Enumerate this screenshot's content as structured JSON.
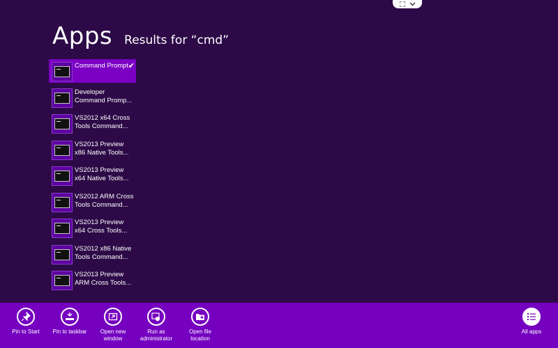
{
  "header": {
    "title": "Apps",
    "subtitle": "Results for “cmd”"
  },
  "results": [
    {
      "label": "Command Prompt",
      "selected": true,
      "icon": "command-prompt-icon"
    },
    {
      "label": "Developer\nCommand Promp...",
      "selected": false,
      "icon": "command-prompt-icon"
    },
    {
      "label": "VS2012 x64 Cross\nTools Command...",
      "selected": false,
      "icon": "command-prompt-icon"
    },
    {
      "label": "VS2013 Preview\nx86 Native Tools...",
      "selected": false,
      "icon": "command-prompt-icon"
    },
    {
      "label": "VS2013 Preview\nx64 Native Tools...",
      "selected": false,
      "icon": "command-prompt-icon"
    },
    {
      "label": "VS2012 ARM Cross\nTools Command...",
      "selected": false,
      "icon": "command-prompt-icon"
    },
    {
      "label": "VS2013 Preview\nx64 Cross Tools...",
      "selected": false,
      "icon": "command-prompt-icon"
    },
    {
      "label": "VS2012 x86 Native\nTools Command...",
      "selected": false,
      "icon": "command-prompt-icon"
    },
    {
      "label": "VS2013 Preview\nARM Cross Tools...",
      "selected": false,
      "icon": "command-prompt-icon"
    }
  ],
  "appbar": {
    "pin_start": "Pin to Start",
    "pin_taskbar": "Pin to taskbar",
    "open_new_window": "Open new\nwindow",
    "run_admin": "Run as\nadministrator",
    "open_location": "Open file\nlocation",
    "all_apps": "All apps"
  },
  "colors": {
    "background": "#2d0a47",
    "accent": "#7500c0",
    "selected": "#7b00c4"
  }
}
